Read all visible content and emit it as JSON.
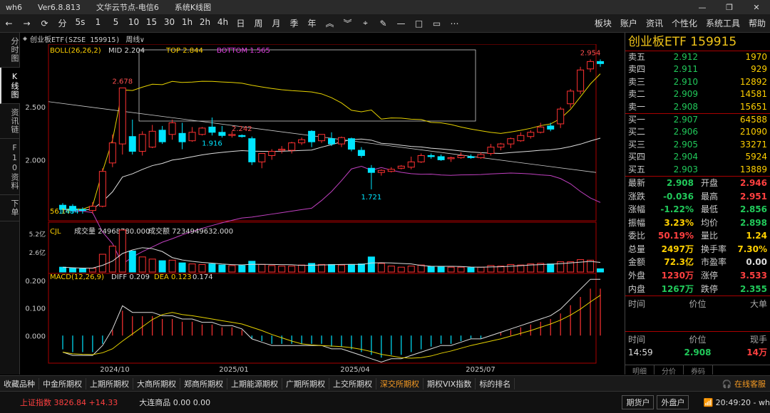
{
  "titlebar": {
    "app": "wh6",
    "version": "Ver6.8.813",
    "server": "文华云节点-电信6",
    "mode": "系统K线图"
  },
  "toolbar": {
    "periods": [
      "分",
      "5s",
      "1",
      "5",
      "10",
      "15",
      "30",
      "1h",
      "2h",
      "4h",
      "日",
      "周",
      "月",
      "季",
      "年"
    ],
    "menus": [
      "板块",
      "账户",
      "资讯",
      "个性化",
      "系统工具",
      "帮助"
    ]
  },
  "leftbar": [
    "分时图",
    "K线图",
    "资讯链",
    "F10资料",
    "下单"
  ],
  "subheader": {
    "name": "创业板ETF(SZSE 159915)",
    "period": "周线"
  },
  "indicators": {
    "boll": "BOLL(26,26,2)",
    "mid": "MID 2.204",
    "top": "TOP 2.844",
    "bottom": "BOTTOM 1.565",
    "cjl": "CJL",
    "vol_label": "成交量 24968780.000",
    "amount_label": "成交额 7234949632.000",
    "macd": "MACD(12,26,9)",
    "diff": "DIFF 0.209",
    "dea": "DEA 0.123",
    "macd_val": "0.174"
  },
  "price_axis": [
    "2.500",
    "2.000"
  ],
  "vol_axis": [
    "5.2亿",
    "2.6亿"
  ],
  "macd_axis": [
    "0.200",
    "0.100",
    "0.000"
  ],
  "date_axis": [
    "2024/10",
    "2025/01",
    "2025/04",
    "2025/07"
  ],
  "annotations": {
    "high1": "2.678",
    "mid_high": "2.242",
    "low1": "1.916",
    "low2": "1.721",
    "top": "2.954",
    "bottom_left": "1.484",
    "left_label": "56.14"
  },
  "chart_data": {
    "type": "candlestick",
    "ylim": [
      1.45,
      3.0
    ],
    "candles": [
      [
        1.57,
        1.53,
        1.59,
        1.5
      ],
      [
        1.56,
        1.52,
        1.58,
        1.49
      ],
      [
        1.53,
        1.52,
        1.55,
        1.49
      ],
      [
        1.52,
        1.56,
        1.6,
        1.49
      ],
      [
        1.56,
        1.89,
        1.92,
        1.55
      ],
      [
        1.97,
        2.16,
        2.24,
        1.93
      ],
      [
        2.15,
        2.68,
        2.68,
        2.05
      ],
      [
        2.22,
        2.08,
        2.38,
        2.05
      ],
      [
        2.08,
        2.24,
        2.27,
        2.04
      ],
      [
        2.12,
        2.27,
        2.33,
        2.11
      ],
      [
        2.28,
        2.17,
        2.32,
        2.15
      ],
      [
        2.24,
        2.35,
        2.38,
        2.19
      ],
      [
        2.25,
        2.17,
        2.35,
        2.1
      ],
      [
        2.18,
        2.26,
        2.31,
        2.17
      ],
      [
        2.24,
        2.3,
        2.31,
        2.23
      ],
      [
        2.31,
        2.26,
        2.4,
        2.23
      ],
      [
        2.26,
        2.23,
        2.32,
        2.21
      ],
      [
        2.23,
        2.24,
        2.27,
        2.21
      ],
      [
        2.23,
        2.22,
        2.24,
        2.21
      ],
      [
        2.2,
        1.98,
        2.22,
        1.95
      ],
      [
        1.98,
        2.06,
        2.06,
        1.92
      ],
      [
        2.04,
        2.08,
        2.1,
        2.0
      ],
      [
        2.09,
        2.1,
        2.13,
        2.06
      ],
      [
        2.09,
        2.16,
        2.17,
        2.06
      ],
      [
        2.16,
        2.19,
        2.21,
        2.14
      ],
      [
        2.27,
        2.17,
        2.28,
        2.12
      ],
      [
        2.18,
        2.24,
        2.24,
        2.16
      ],
      [
        2.2,
        2.15,
        2.26,
        2.13
      ],
      [
        2.15,
        2.21,
        2.22,
        2.12
      ],
      [
        2.2,
        2.1,
        2.21,
        2.08
      ],
      [
        2.09,
        2.04,
        2.12,
        2.02
      ],
      [
        1.92,
        1.88,
        1.95,
        1.72
      ],
      [
        1.88,
        1.9,
        1.91,
        1.85
      ],
      [
        1.89,
        1.91,
        1.93,
        1.88
      ],
      [
        1.92,
        1.94,
        1.95,
        1.91
      ],
      [
        1.93,
        1.98,
        2.03,
        1.91
      ],
      [
        1.98,
        2.04,
        2.06,
        1.97
      ],
      [
        2.04,
        2.03,
        2.06,
        2.01
      ],
      [
        2.03,
        2.0,
        2.05,
        1.99
      ],
      [
        2.01,
        2.02,
        2.03,
        1.98
      ],
      [
        2.02,
        2.04,
        2.07,
        2.01
      ],
      [
        2.03,
        2.02,
        2.05,
        2.01
      ],
      [
        2.02,
        2.05,
        2.07,
        2.01
      ],
      [
        2.06,
        2.12,
        2.15,
        2.04
      ],
      [
        2.12,
        2.15,
        2.16,
        2.09
      ],
      [
        2.15,
        2.2,
        2.21,
        2.11
      ],
      [
        2.18,
        2.23,
        2.26,
        2.17
      ],
      [
        2.22,
        2.26,
        2.28,
        2.2
      ],
      [
        2.26,
        2.31,
        2.35,
        2.25
      ],
      [
        2.32,
        2.29,
        2.35,
        2.27
      ],
      [
        2.34,
        2.48,
        2.5,
        2.3
      ],
      [
        2.53,
        2.65,
        2.67,
        2.49
      ],
      [
        2.65,
        2.85,
        2.88,
        2.62
      ],
      [
        2.86,
        2.93,
        2.95,
        2.83
      ],
      [
        2.93,
        2.91,
        2.95,
        2.88
      ]
    ],
    "volumes": [
      0.9,
      0.7,
      0.6,
      0.7,
      3.3,
      4.8,
      7.8,
      3.9,
      2.8,
      2.4,
      2.1,
      2.2,
      1.7,
      1.5,
      1.4,
      1.5,
      1.3,
      1.2,
      1.2,
      2.0,
      1.4,
      1.2,
      1.1,
      1.1,
      1.3,
      1.6,
      1.4,
      1.4,
      1.3,
      1.4,
      1.5,
      2.8,
      1.6,
      1.1,
      0.9,
      1.1,
      1.3,
      1.0,
      1.0,
      0.9,
      0.9,
      0.8,
      0.9,
      1.2,
      1.1,
      1.4,
      1.3,
      1.5,
      1.6,
      1.5,
      1.9,
      1.9,
      2.3,
      2.2,
      0.6
    ],
    "macd_hist": [
      -0.05,
      -0.06,
      -0.06,
      -0.06,
      -0.03,
      0.02,
      0.09,
      0.07,
      0.07,
      0.07,
      0.06,
      0.06,
      0.05,
      0.05,
      0.04,
      0.04,
      0.03,
      0.03,
      0.02,
      -0.01,
      -0.02,
      -0.03,
      -0.03,
      -0.03,
      -0.03,
      -0.03,
      -0.03,
      -0.04,
      -0.04,
      -0.05,
      -0.06,
      -0.07,
      -0.08,
      -0.07,
      -0.07,
      -0.06,
      -0.05,
      -0.04,
      -0.03,
      -0.03,
      -0.02,
      -0.01,
      -0.01,
      0.0,
      0.01,
      0.02,
      0.03,
      0.04,
      0.05,
      0.06,
      0.08,
      0.11,
      0.14,
      0.17,
      0.17
    ]
  },
  "panel": {
    "title": "创业板ETF  159915",
    "asks": [
      [
        "卖五",
        "2.912",
        "1970"
      ],
      [
        "卖四",
        "2.911",
        "929"
      ],
      [
        "卖三",
        "2.910",
        "12892"
      ],
      [
        "卖二",
        "2.909",
        "14581"
      ],
      [
        "卖一",
        "2.908",
        "15651"
      ]
    ],
    "bids": [
      [
        "买一",
        "2.907",
        "64588"
      ],
      [
        "买二",
        "2.906",
        "21090"
      ],
      [
        "买三",
        "2.905",
        "33271"
      ],
      [
        "买四",
        "2.904",
        "5924"
      ],
      [
        "买五",
        "2.903",
        "13889"
      ]
    ],
    "stats": [
      [
        "最新",
        "2.908",
        "开盘",
        "2.946",
        "green",
        "red"
      ],
      [
        "涨跌",
        "-0.036",
        "最高",
        "2.951",
        "green",
        "red"
      ],
      [
        "涨幅",
        "-1.22%",
        "最低",
        "2.856",
        "green",
        "green"
      ],
      [
        "振幅",
        "3.23%",
        "均价",
        "2.898",
        "yellow",
        "green"
      ],
      [
        "委比",
        "50.19%",
        "量比",
        "1.24",
        "red",
        "yellow"
      ],
      [
        "总量",
        "2497万",
        "换手率",
        "7.30%",
        "yellow",
        "yellow"
      ],
      [
        "金额",
        "72.3亿",
        "市盈率",
        "0.00",
        "yellow",
        "white"
      ],
      [
        "外盘",
        "1230万",
        "涨停",
        "3.533",
        "red",
        "red"
      ],
      [
        "内盘",
        "1267万",
        "跌停",
        "2.355",
        "green",
        "green"
      ]
    ],
    "trade_hdr": [
      "时间",
      "价位",
      "大单"
    ],
    "trade_hdr2": [
      "时间",
      "价位",
      "现手"
    ],
    "trade_row": [
      "14:59",
      "2.908",
      "14万"
    ],
    "tabs": [
      "明细",
      "分价",
      "券码"
    ]
  },
  "bottom_tabs": [
    "收藏品种",
    "中金所期权",
    "上期所期权",
    "大商所期权",
    "郑商所期权",
    "上期能源期权",
    "广期所期权",
    "上交所期权",
    "深交所期权",
    "期权VIX指数",
    "标的排名"
  ],
  "bottom_active": 8,
  "kefu": "在线客服",
  "status": {
    "index": "上证指数  3826.84  +14.33",
    "spot": "大连商品  0.00  0.00",
    "btn1": "期货户",
    "btn2": "外盘户",
    "time": "20:49:20 - wh"
  }
}
